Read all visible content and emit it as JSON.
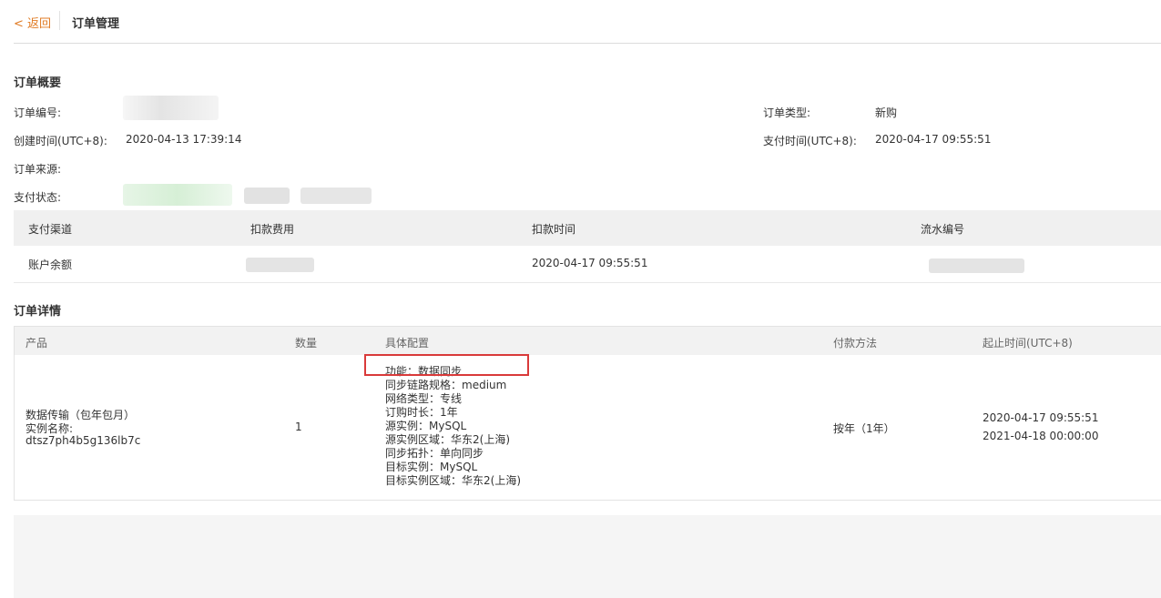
{
  "header": {
    "back_label": "< 返回",
    "title": "订单管理"
  },
  "overview": {
    "title": "订单概要",
    "order_no_label": "订单编号:",
    "created_label": "创建时间(UTC+8):",
    "created_value": "2020-04-13 17:39:14",
    "source_label": "订单来源:",
    "pay_status_label": "支付状态:",
    "order_type_label": "订单类型:",
    "order_type_value": "新购",
    "paid_label": "支付时间(UTC+8):",
    "paid_value": "2020-04-17 09:55:51"
  },
  "payment_table": {
    "headers": [
      "支付渠道",
      "扣款费用",
      "扣款时间",
      "流水编号"
    ],
    "row": {
      "channel": "账户余额",
      "time": "2020-04-17 09:55:51"
    }
  },
  "details": {
    "title": "订单详情",
    "headers": [
      "产品",
      "数量",
      "具体配置",
      "付款方法",
      "起止时间(UTC+8)"
    ],
    "row": {
      "product_line1": "数据传输（包年包月）",
      "product_line2": "实例名称:",
      "product_line3": "dtsz7ph4b5g136lb7c",
      "quantity": "1",
      "config": [
        "功能：数据同步",
        "同步链路规格：medium",
        "网络类型：专线",
        "订购时长：1年",
        "源实例：MySQL",
        "源实例区域：华东2(上海)",
        "同步拓扑：单向同步",
        "目标实例：MySQL",
        "目标实例区域：华东2(上海)"
      ],
      "payment_method": "按年（1年）",
      "start_time": "2020-04-17 09:55:51",
      "end_time": "2021-04-18 00:00:00"
    }
  },
  "colors": {
    "accent": "#e07b24",
    "highlight": "#d93a3a"
  }
}
